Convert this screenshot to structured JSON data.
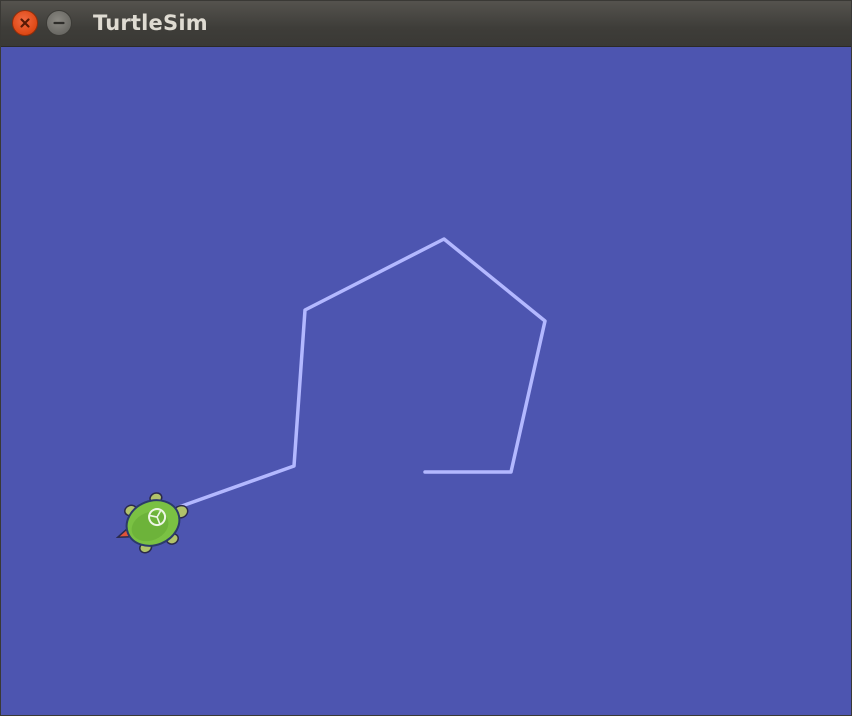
{
  "window": {
    "title": "TurtleSim",
    "buttons": [
      {
        "name": "close",
        "icon": "close-icon"
      },
      {
        "name": "minimize",
        "icon": "minimize-icon"
      }
    ]
  },
  "canvas": {
    "background_color": "#4d55b0",
    "pen_color": "#b3b8ff",
    "turtle_icon": "turtle-icon",
    "turtle_shell_color": "#7ac143"
  }
}
